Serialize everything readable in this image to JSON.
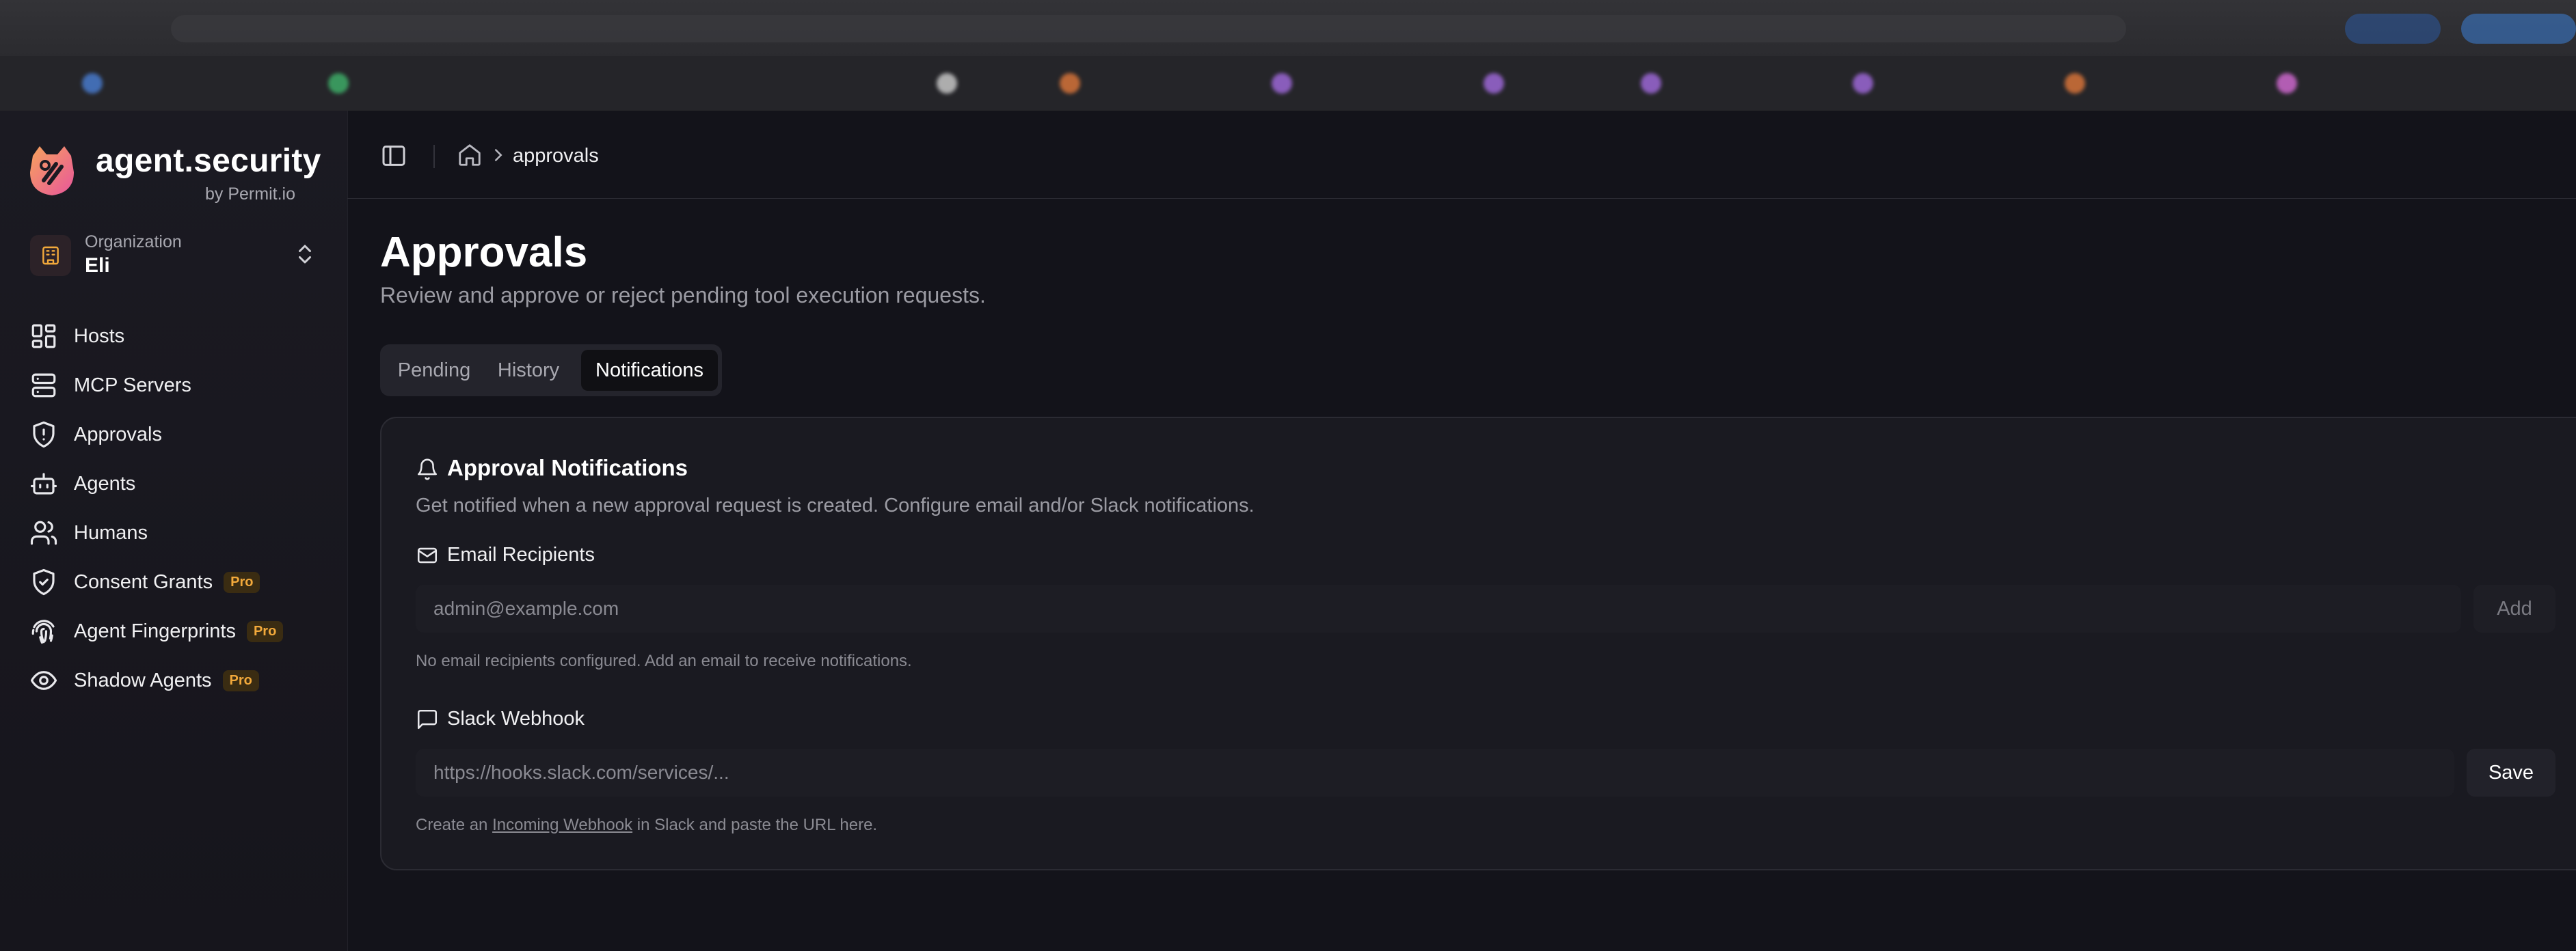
{
  "brand": {
    "name": "agent.security",
    "sub": "by Permit.io"
  },
  "org": {
    "label": "Organization",
    "name": "Eli"
  },
  "nav": [
    {
      "label": "Hosts",
      "icon": "grid-icon"
    },
    {
      "label": "MCP Servers",
      "icon": "server-icon"
    },
    {
      "label": "Approvals",
      "icon": "shield-alert-icon"
    },
    {
      "label": "Agents",
      "icon": "bot-icon"
    },
    {
      "label": "Humans",
      "icon": "users-icon"
    },
    {
      "label": "Consent Grants",
      "icon": "shield-check-icon",
      "badge": "Pro"
    },
    {
      "label": "Agent Fingerprints",
      "icon": "fingerprint-icon",
      "badge": "Pro"
    },
    {
      "label": "Shadow Agents",
      "icon": "eye-icon",
      "badge": "Pro"
    }
  ],
  "breadcrumb": {
    "current": "approvals"
  },
  "page": {
    "title": "Approvals",
    "subtitle": "Review and approve or reject pending tool execution requests."
  },
  "tabs": [
    {
      "label": "Pending",
      "active": false
    },
    {
      "label": "History",
      "active": false
    },
    {
      "label": "Notifications",
      "active": true
    }
  ],
  "card": {
    "title": "Approval Notifications",
    "description": "Get notified when a new approval request is created. Configure email and/or Slack notifications.",
    "email": {
      "label": "Email Recipients",
      "placeholder": "admin@example.com",
      "add_label": "Add",
      "hint": "No email recipients configured. Add an email to receive notifications."
    },
    "slack": {
      "label": "Slack Webhook",
      "placeholder": "https://hooks.slack.com/services/...",
      "save_label": "Save",
      "hint_before": "Create an ",
      "hint_link": "Incoming Webhook",
      "hint_after": " in Slack and paste the URL here."
    }
  },
  "colors": {
    "accent_pro": "#f2a93b",
    "logo_gradient": [
      "#f7a35c",
      "#e8569b"
    ]
  }
}
